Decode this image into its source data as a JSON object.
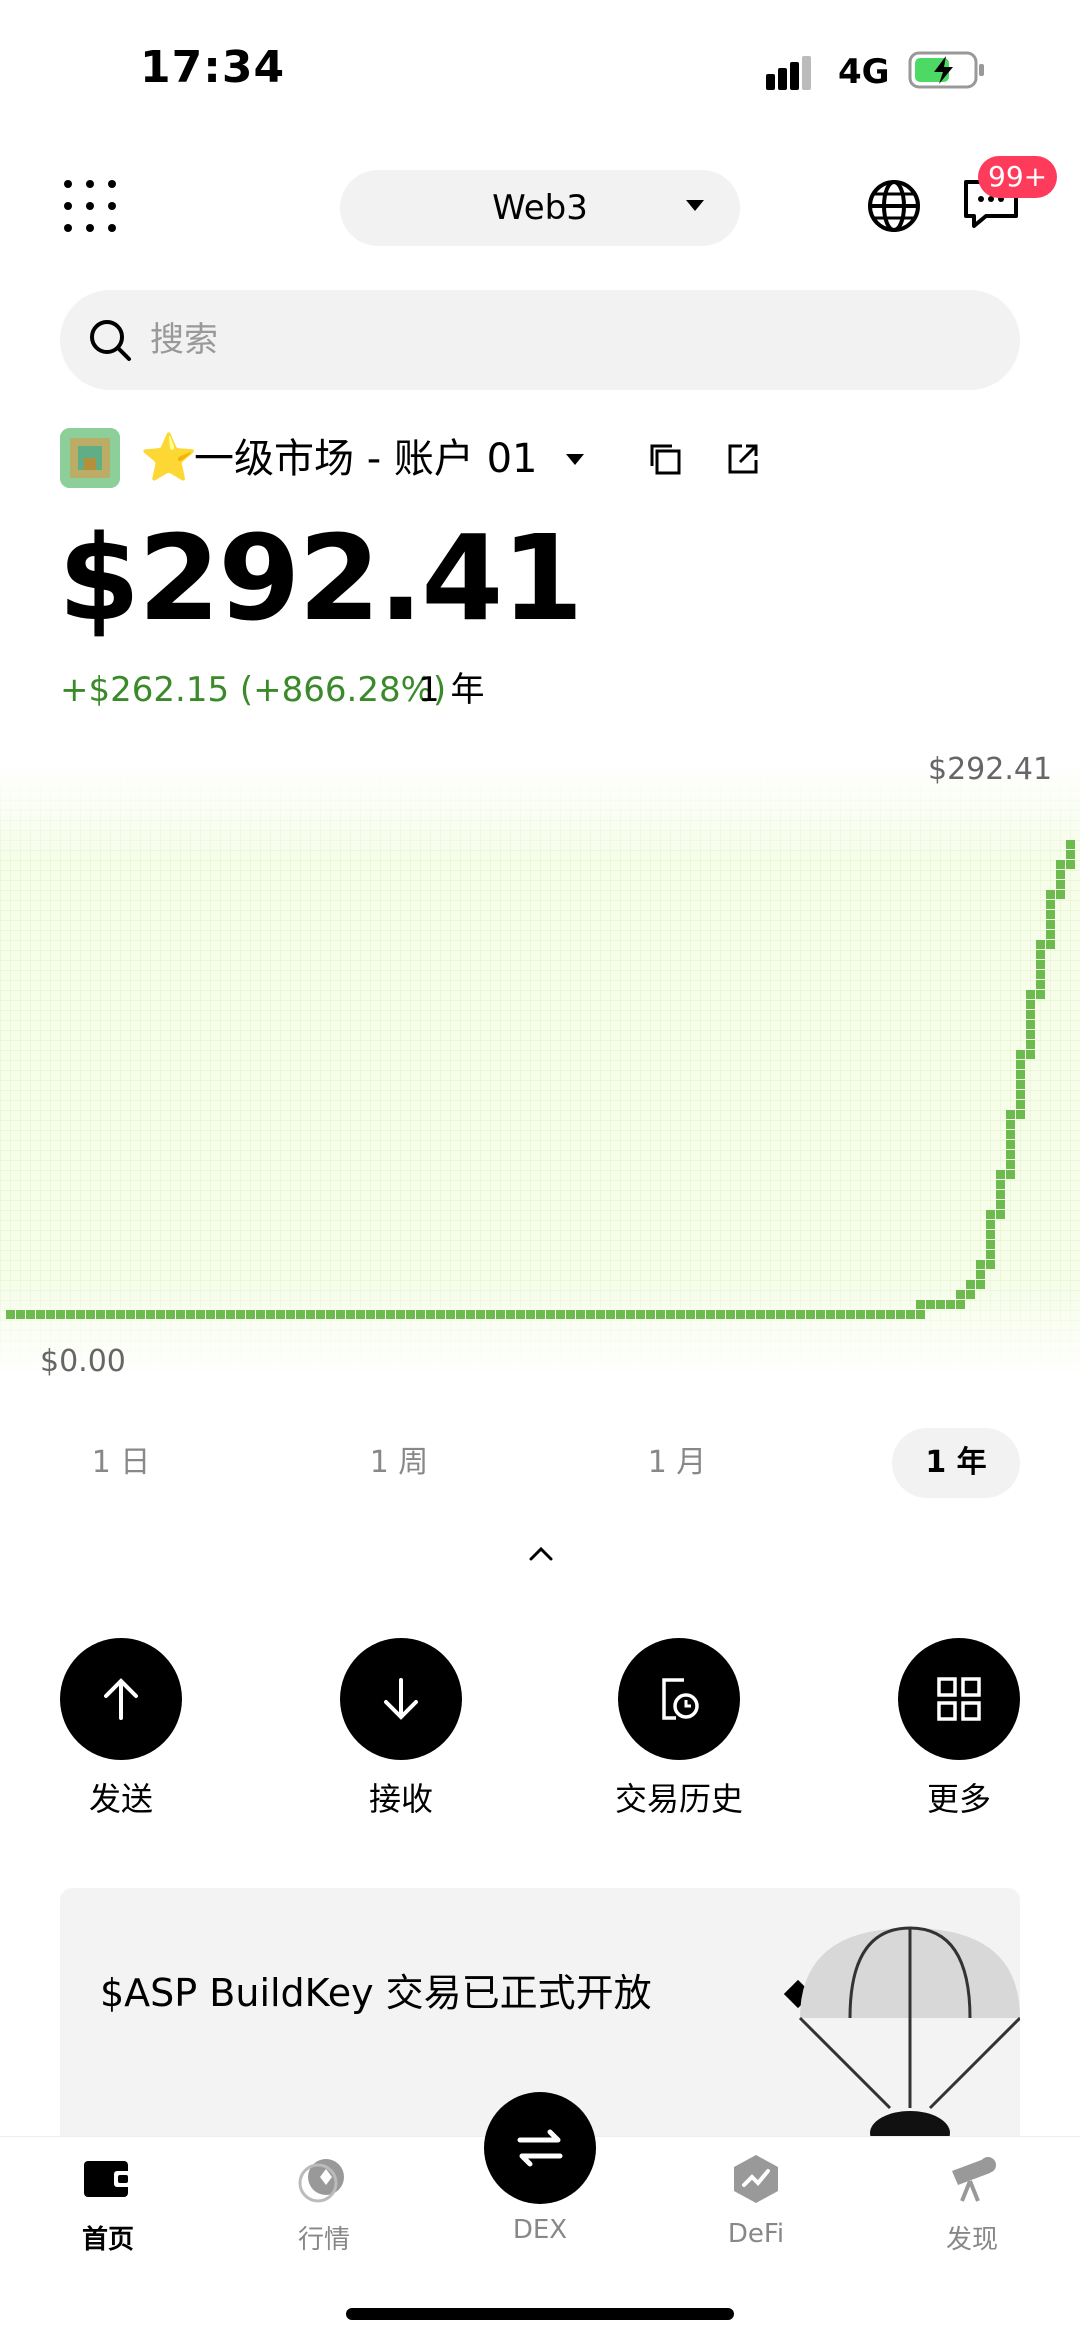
{
  "status_bar": {
    "time": "17:34",
    "network": "4G"
  },
  "header": {
    "network_selector": "Web3",
    "badge": "99+"
  },
  "search": {
    "placeholder": "搜索"
  },
  "account": {
    "star": "⭐",
    "name": "一级市场 - 账户 01"
  },
  "portfolio": {
    "balance": "$292.41",
    "change": "+$262.15 (+866.28%)",
    "period": "1 年"
  },
  "chart_data": {
    "type": "area",
    "title": "",
    "xlabel": "",
    "ylabel": "",
    "max_label": "$292.41",
    "min_label": "$0.00",
    "ylim": [
      0,
      292.41
    ],
    "x": [
      0,
      10,
      20,
      30,
      40,
      50,
      60,
      70,
      80,
      84,
      86,
      88,
      90,
      91,
      92,
      93,
      94,
      95,
      96,
      97,
      98,
      99,
      100
    ],
    "values": [
      8,
      8,
      8,
      8,
      8,
      8,
      8,
      8,
      8,
      8,
      10,
      14,
      22,
      40,
      70,
      100,
      140,
      175,
      210,
      245,
      268,
      282,
      292.41
    ],
    "color": "#6dbb4e"
  },
  "range_tabs": {
    "d1": "1 日",
    "w1": "1 周",
    "m1": "1 月",
    "y1": "1 年"
  },
  "actions": {
    "send": "发送",
    "receive": "接收",
    "history": "交易历史",
    "more": "更多"
  },
  "banner": {
    "text": "$ASP BuildKey 交易已正式开放"
  },
  "nav": {
    "home": "首页",
    "market": "行情",
    "dex": "DEX",
    "defi": "DeFi",
    "discover": "发现"
  }
}
